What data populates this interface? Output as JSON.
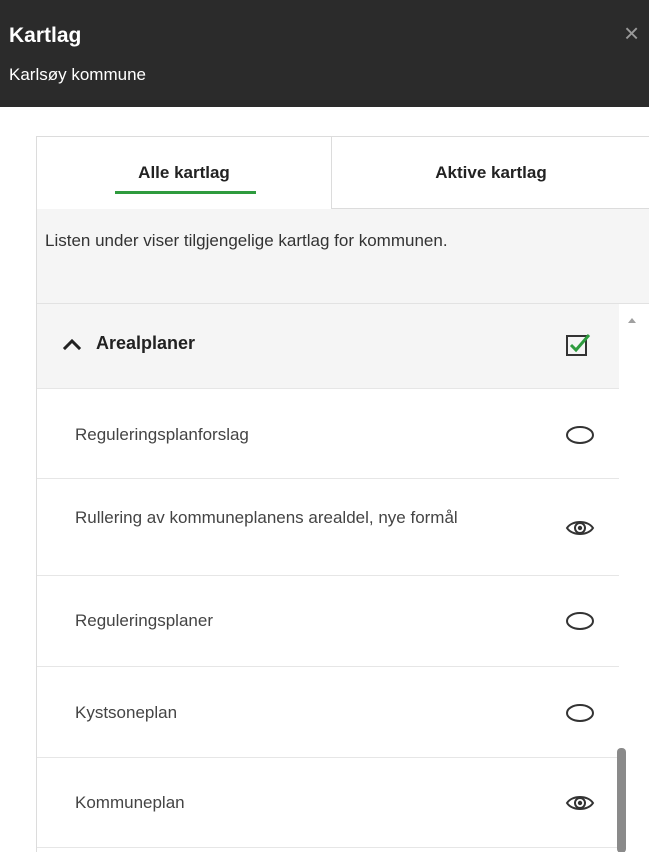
{
  "header": {
    "title": "Kartlag",
    "subtitle": "Karlsøy kommune",
    "close_label": "×"
  },
  "tabs": [
    {
      "label": "Alle kartlag",
      "active": true
    },
    {
      "label": "Aktive kartlag",
      "active": false
    }
  ],
  "info_text": "Listen under viser tilgjengelige kartlag for kommunen.",
  "group": {
    "label": "Arealplaner",
    "expanded": true,
    "checked": true
  },
  "layers": [
    {
      "label": "Reguleringsplanforslag",
      "visible": false
    },
    {
      "label": "Rullering av kommuneplanens arealdel, nye formål",
      "visible": true
    },
    {
      "label": "Reguleringsplaner",
      "visible": false
    },
    {
      "label": "Kystsoneplan",
      "visible": false
    },
    {
      "label": "Kommuneplan",
      "visible": true
    }
  ],
  "colors": {
    "header_bg": "#2b2b2b",
    "accent_green": "#2e9b3e",
    "panel_grey": "#f5f5f5"
  }
}
